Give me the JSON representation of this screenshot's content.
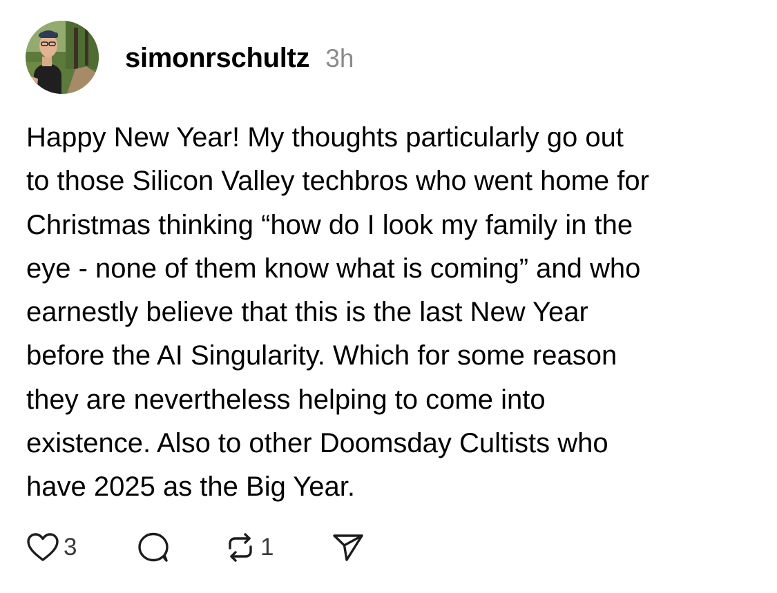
{
  "post": {
    "author": {
      "username": "simonrschultz",
      "avatar_icon": "profile-photo-avatar"
    },
    "timestamp": "3h",
    "text_lines": [
      "Happy New Year! My thoughts particularly go out",
      "to those Silicon Valley techbros who went home for",
      "Christmas thinking “how do I look my family in the",
      "eye - none of them know what is coming” and who",
      "earnestly believe that this is the last New Year",
      "before the AI Singularity. Which for some reason",
      "they are nevertheless helping to come into",
      "existence. Also to other Doomsday Cultists who",
      "have 2025 as the Big Year."
    ],
    "actions": {
      "like": {
        "icon": "heart-icon",
        "count": "3"
      },
      "reply": {
        "icon": "speech-bubble-icon"
      },
      "repost": {
        "icon": "repost-icon",
        "count": "1"
      },
      "share": {
        "icon": "paper-plane-icon"
      }
    }
  },
  "colors": {
    "text": "#000000",
    "timestamp": "#8a8a8a",
    "icon": "#1c1c1c",
    "background": "#ffffff"
  }
}
